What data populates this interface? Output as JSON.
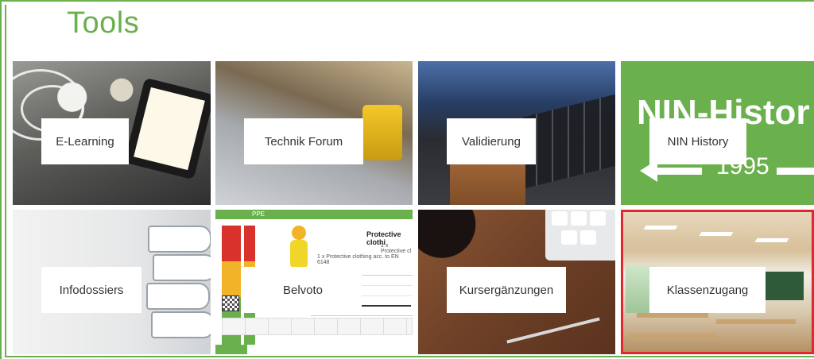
{
  "page": {
    "title": "Tools"
  },
  "colors": {
    "accent": "#6ab04c",
    "selected_border": "#e0282e",
    "label_text": "#333333"
  },
  "tiles": [
    {
      "label": "E-Learning"
    },
    {
      "label": "Technik Forum"
    },
    {
      "label": "Validierung"
    },
    {
      "label": "NIN History",
      "banner_title": "NIN-Histor",
      "banner_year": "1995"
    },
    {
      "label": "Infodossiers"
    },
    {
      "label": "Belvoto",
      "app_bar": "PPE",
      "heading": "Protective clothi",
      "sub1": "2 x Protective cl",
      "sub2": "1 x Protective clothing acc. to EN 6148"
    },
    {
      "label": "Kursergänzungen"
    },
    {
      "label": "Klassenzugang",
      "selected": true
    }
  ]
}
